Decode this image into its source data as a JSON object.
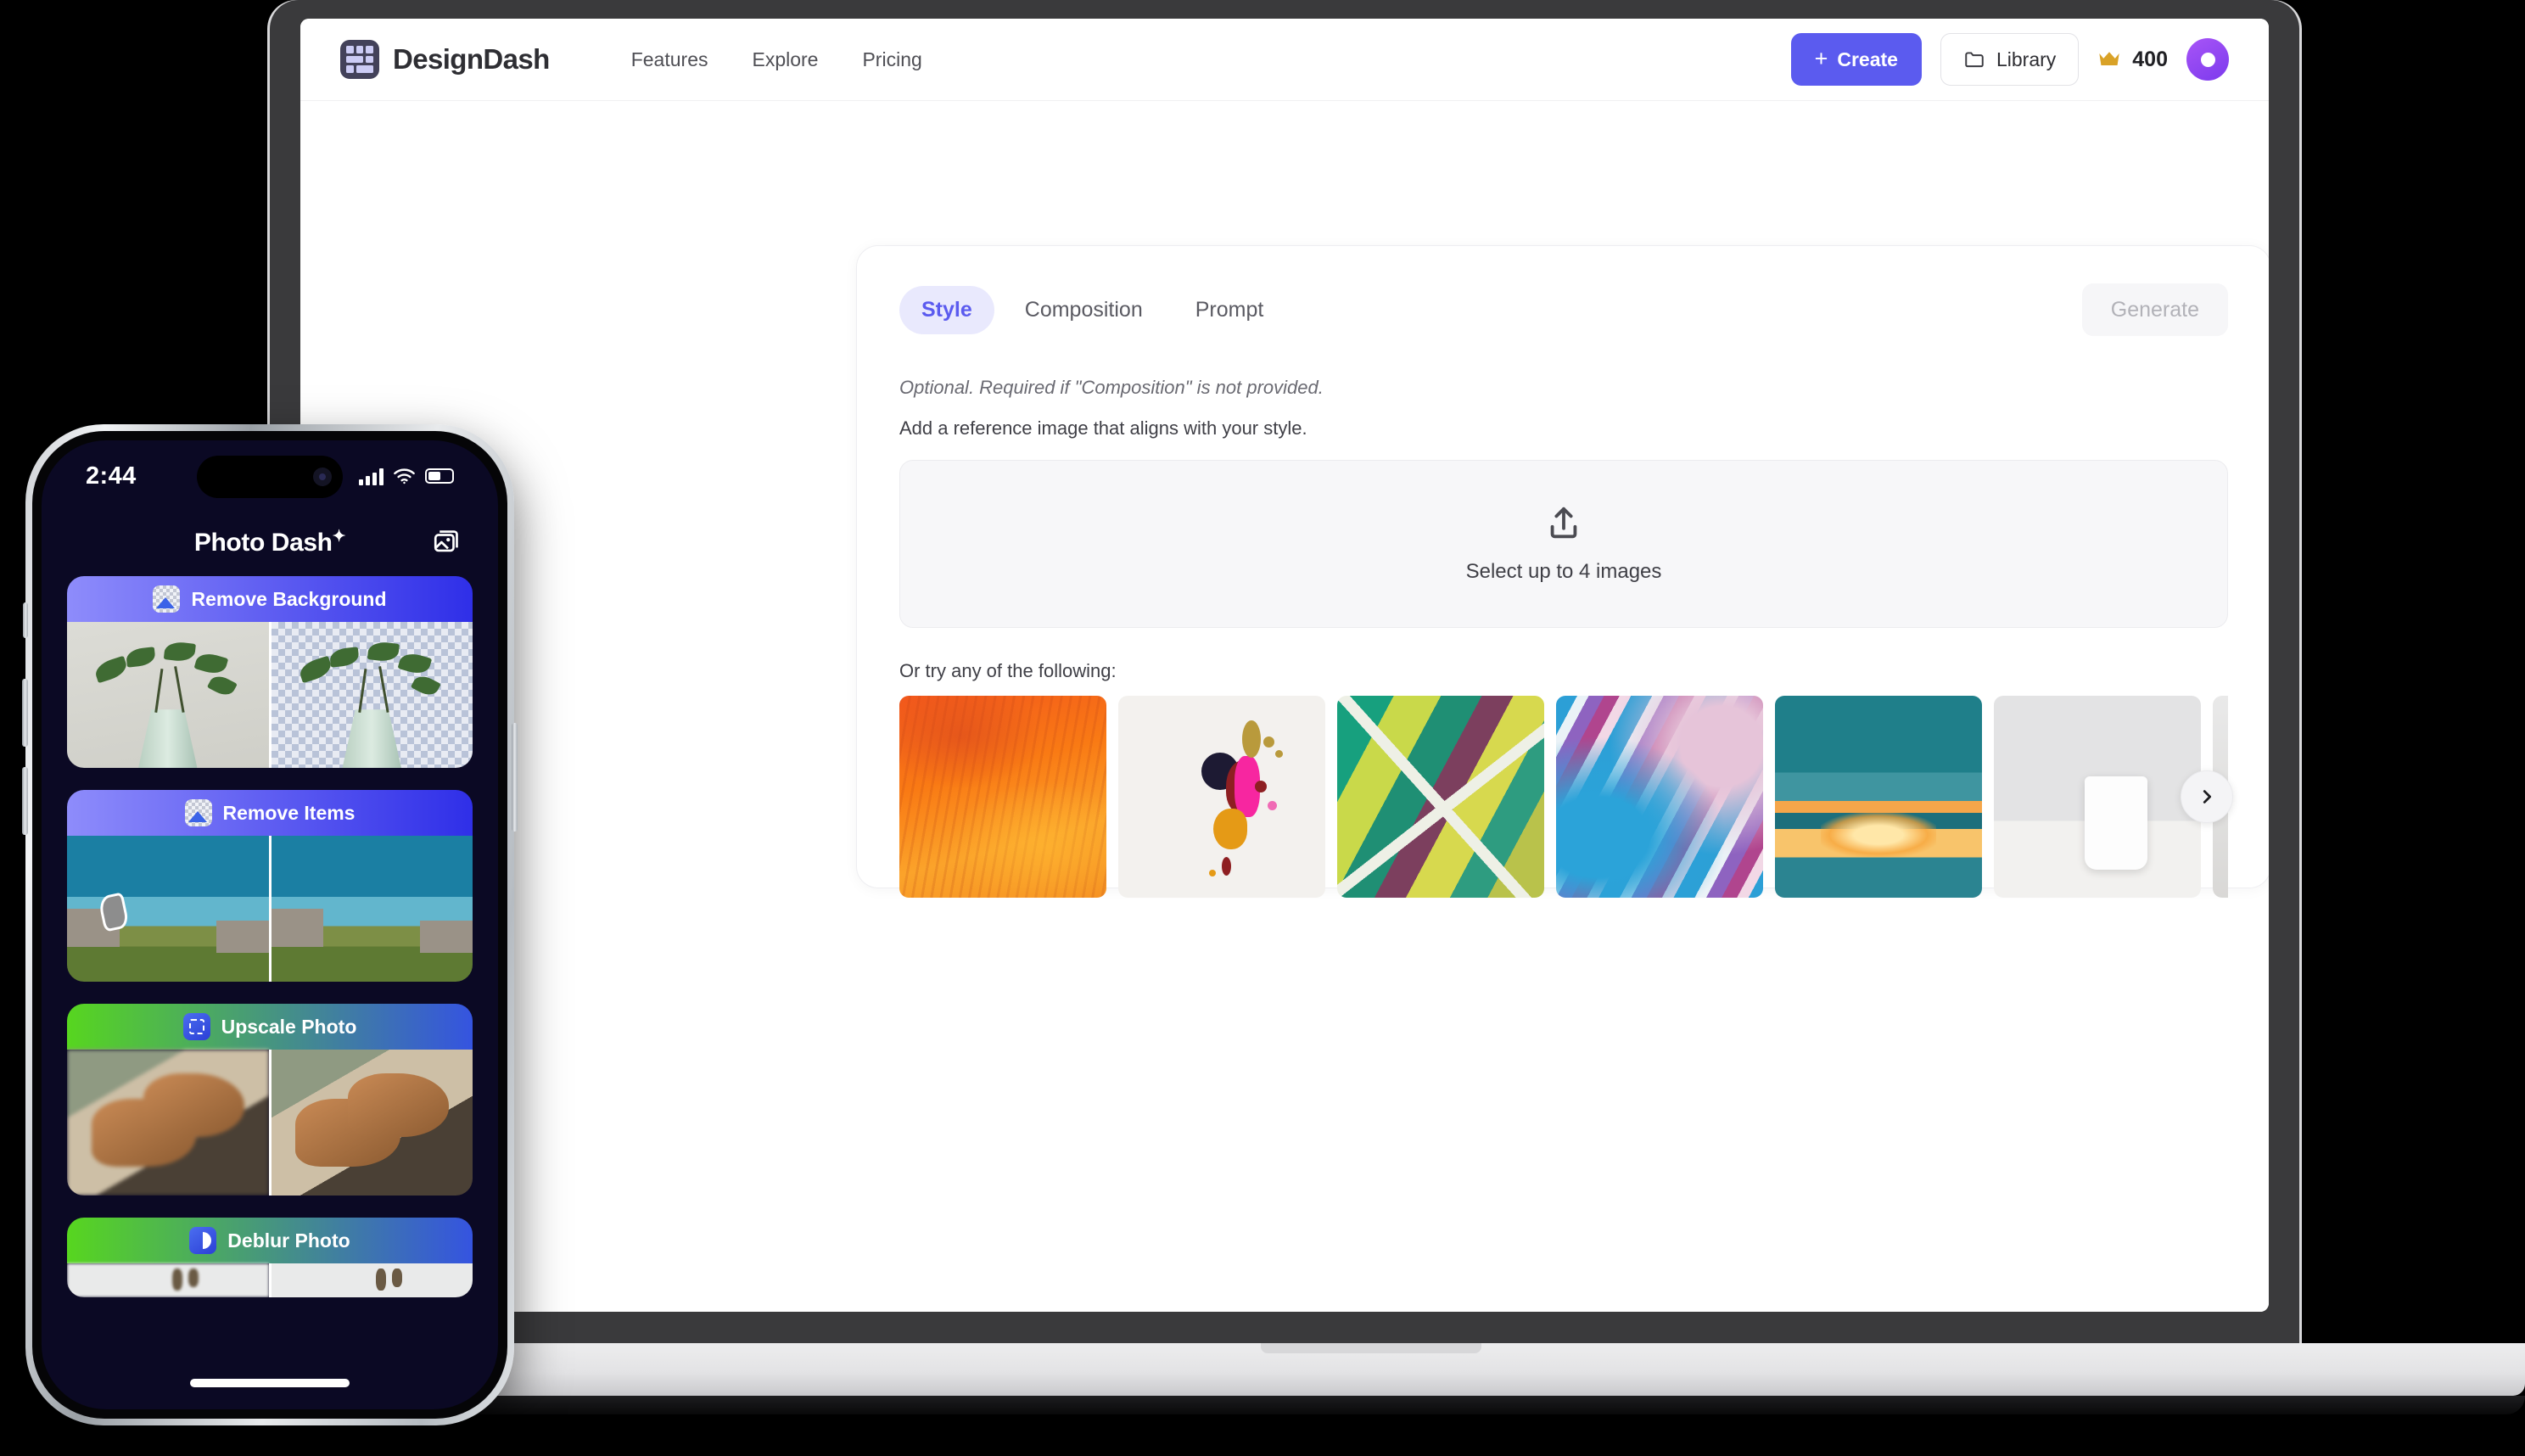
{
  "laptop": {
    "header": {
      "brand_name": "DesignDash",
      "logo_icon": "grid-logo-icon",
      "nav_links": [
        {
          "label": "Features"
        },
        {
          "label": "Explore"
        },
        {
          "label": "Pricing"
        }
      ],
      "create_button": {
        "label": "Create",
        "icon": "plus-icon",
        "color": "#5b5bef"
      },
      "library_button": {
        "label": "Library",
        "icon": "folder-icon"
      },
      "credits": {
        "icon": "crown-icon",
        "value": "400",
        "color": "#d9a227"
      },
      "avatar": {
        "icon": "user-avatar-icon",
        "color": "#8b5cf6"
      }
    },
    "panel": {
      "tabs": [
        {
          "label": "Style",
          "active": true
        },
        {
          "label": "Composition",
          "active": false
        },
        {
          "label": "Prompt",
          "active": false
        }
      ],
      "generate_button": {
        "label": "Generate",
        "disabled": true
      },
      "hint_italic": "Optional. Required if \"Composition\" is not provided.",
      "hint_plain": "Add a reference image that aligns with your style.",
      "dropzone": {
        "icon": "upload-icon",
        "label": "Select up to 4 images"
      },
      "gallery_label": "Or try any of the following:",
      "gallery": [
        {
          "name": "orange-wood-texture",
          "art": "art-orange"
        },
        {
          "name": "paint-splatter",
          "art": "art-splat"
        },
        {
          "name": "geometric-triangles",
          "art": "art-geo"
        },
        {
          "name": "blue-purple-swirl",
          "art": "art-swirl-blue"
        },
        {
          "name": "teal-sunset-lake",
          "art": "art-sunset"
        },
        {
          "name": "white-mug-still-life",
          "art": "art-mug"
        },
        {
          "name": "next-preview",
          "art": "art-partial",
          "partial": true
        }
      ],
      "carousel_next": {
        "icon": "chevron-right-icon"
      }
    }
  },
  "phone": {
    "status_bar": {
      "time": "2:44",
      "signal_icon": "cellular-signal-icon",
      "wifi_icon": "wifi-icon",
      "battery_icon": "battery-icon"
    },
    "app_title": "Photo Dash",
    "app_title_sparkle": "✦",
    "photos_icon": "photos-library-icon",
    "cards": [
      {
        "title": "Remove Background",
        "icon": "image-checker-icon",
        "gradient": "grad-blue",
        "before": "plant-before",
        "after": "plant-after"
      },
      {
        "title": "Remove Items",
        "icon": "image-checker-icon",
        "gradient": "grad-blue",
        "before": "coast-with-runner",
        "after": "coast-clean"
      },
      {
        "title": "Upscale Photo",
        "icon": "expand-icon",
        "gradient": "grad-green",
        "before": "shoes-blurry",
        "after": "shoes-sharp"
      },
      {
        "title": "Deblur Photo",
        "icon": "deblur-icon",
        "gradient": "grad-green",
        "before": "figures-blurry",
        "after": "figures-sharp"
      }
    ]
  }
}
